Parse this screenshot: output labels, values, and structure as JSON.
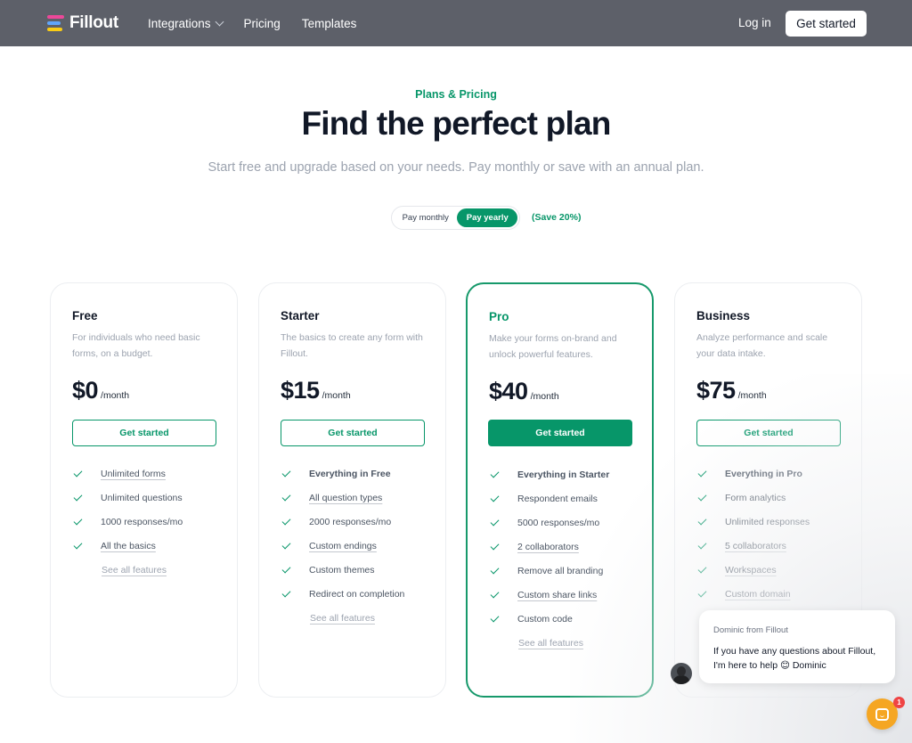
{
  "nav": {
    "brand": "Fillout",
    "links": [
      "Integrations",
      "Pricing",
      "Templates"
    ],
    "login": "Log in",
    "cta": "Get started"
  },
  "hero": {
    "eyebrow": "Plans & Pricing",
    "title": "Find the perfect plan",
    "subtitle": "Start free and upgrade based on your needs. Pay monthly or save with an annual plan."
  },
  "billing": {
    "monthly": "Pay monthly",
    "yearly": "Pay yearly",
    "selected": "yearly",
    "save": "(Save 20%)"
  },
  "plans": [
    {
      "name": "Free",
      "description": "For individuals who need basic forms, on a budget.",
      "price": "$0",
      "period": "/month",
      "cta": "Get started",
      "features": [
        "Unlimited forms",
        "Unlimited questions",
        "1000 responses/mo",
        "All the basics"
      ],
      "see_all": "See all features"
    },
    {
      "name": "Starter",
      "description": "The basics to create any form with Fillout.",
      "price": "$15",
      "period": "/month",
      "cta": "Get started",
      "features": [
        "Everything in Free",
        "All question types",
        "2000 responses/mo",
        "Custom endings",
        "Custom themes",
        "Redirect on completion"
      ],
      "see_all": "See all features"
    },
    {
      "name": "Pro",
      "description": "Make your forms on-brand and unlock powerful features.",
      "price": "$40",
      "period": "/month",
      "cta": "Get started",
      "features": [
        "Everything in Starter",
        "Respondent emails",
        "5000 responses/mo",
        "2 collaborators",
        "Remove all branding",
        "Custom share links",
        "Custom code"
      ],
      "see_all": "See all features"
    },
    {
      "name": "Business",
      "description": "Analyze performance and scale your data intake.",
      "price": "$75",
      "period": "/month",
      "cta": "Get started",
      "features": [
        "Everything in Pro",
        "Form analytics",
        "Unlimited responses",
        "5 collaborators",
        "Workspaces",
        "Custom domain"
      ],
      "see_all": ""
    }
  ],
  "chat": {
    "from": "Dominic from Fillout",
    "message": "If you have any questions about Fillout, I'm here to help 😊 Dominic",
    "badge": "1"
  },
  "colors": {
    "brand_green": "#079669",
    "nav_bg": "#5d6069",
    "launcher": "#f5a623"
  }
}
